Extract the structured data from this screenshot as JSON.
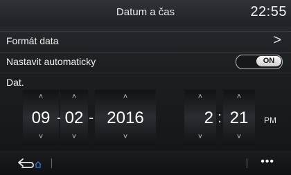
{
  "header": {
    "title": "Datum a čas",
    "clock": "22:55"
  },
  "rows": {
    "format": {
      "label": "Formát data"
    },
    "auto": {
      "label": "Nastavit automaticky",
      "toggle": "ON"
    },
    "date": {
      "label": "Dat."
    }
  },
  "date": {
    "day": "09",
    "month": "02",
    "year": "2016",
    "separator": "-"
  },
  "time": {
    "hour": "2",
    "minute": "21",
    "separator": ":",
    "ampm": "PM"
  },
  "arrows": {
    "up": "˄",
    "down": "˅"
  },
  "footer": {
    "more": "•••"
  },
  "icons": {
    "back": "back-arrow-home-icon",
    "chevron": "chevron-right-icon"
  },
  "colors": {
    "accent": "#3a7bd5"
  }
}
